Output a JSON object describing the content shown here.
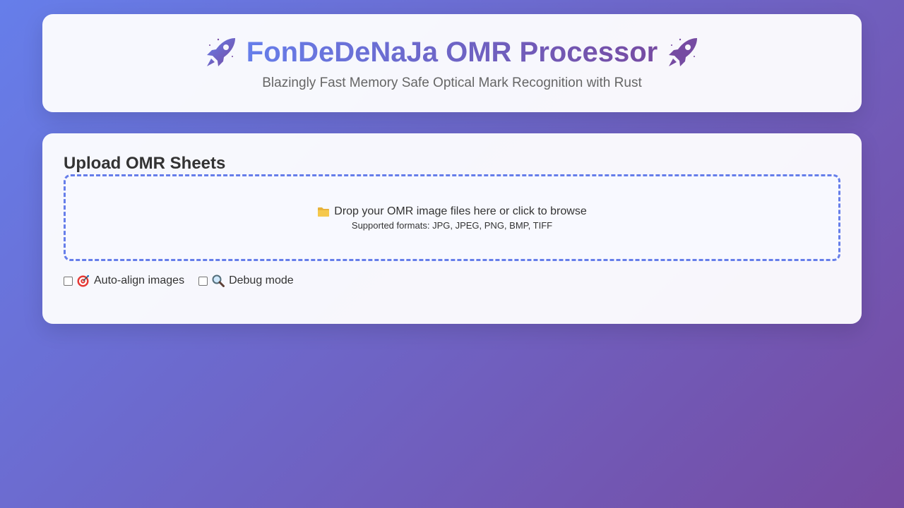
{
  "header": {
    "title": "FonDeDeNaJa OMR Processor",
    "subtitle": "Blazingly Fast Memory Safe Optical Mark Recognition with Rust",
    "left_icon": "rocket-icon",
    "right_icon": "rocket-icon"
  },
  "upload": {
    "section_title": "Upload OMR Sheets",
    "drop_text": "Drop your OMR image files here or click to browse",
    "drop_icon": "folder-icon",
    "formats_text": "Supported formats: JPG, JPEG, PNG, BMP, TIFF"
  },
  "options": {
    "auto_align": {
      "label": "Auto-align images",
      "icon": "target-icon",
      "checked": false
    },
    "debug": {
      "label": "Debug mode",
      "icon": "magnifier-icon",
      "checked": false
    }
  },
  "colors": {
    "accent_start": "#667eea",
    "accent_end": "#764ba2",
    "text_dark": "#333333",
    "text_muted": "#666666"
  }
}
